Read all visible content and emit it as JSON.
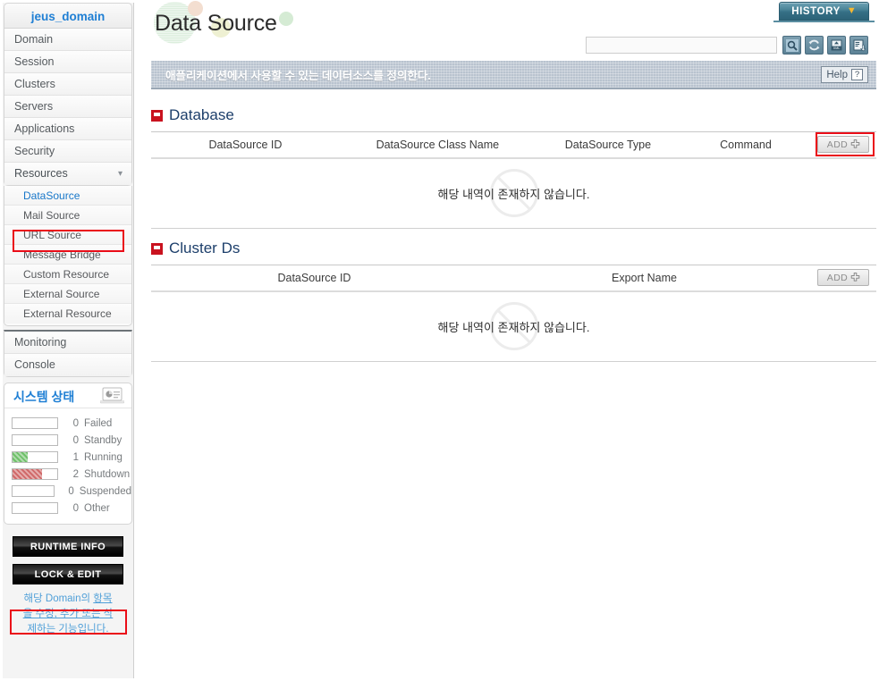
{
  "sidebar": {
    "domain_title": "jeus_domain",
    "nav_items": [
      {
        "label": "Domain"
      },
      {
        "label": "Session"
      },
      {
        "label": "Clusters"
      },
      {
        "label": "Servers"
      },
      {
        "label": "Applications"
      },
      {
        "label": "Security"
      }
    ],
    "resources": {
      "label": "Resources",
      "chevron": "chevron-down"
    },
    "sub_items": [
      {
        "label": "DataSource",
        "active": true
      },
      {
        "label": "Mail Source",
        "active": false
      },
      {
        "label": "URL Source",
        "active": false
      },
      {
        "label": "Message Bridge",
        "active": false
      },
      {
        "label": "Custom Resource",
        "active": false
      },
      {
        "label": "External Source",
        "active": false
      },
      {
        "label": "External Resource",
        "active": false
      }
    ],
    "nav_items2": [
      {
        "label": "Monitoring"
      },
      {
        "label": "Console"
      }
    ],
    "status": {
      "title": "시스템 상태",
      "rows": [
        {
          "count": "0",
          "label": "Failed",
          "fill_pct": 0,
          "color": "none"
        },
        {
          "count": "0",
          "label": "Standby",
          "fill_pct": 0,
          "color": "none"
        },
        {
          "count": "1",
          "label": "Running",
          "fill_pct": 33,
          "color": "green"
        },
        {
          "count": "2",
          "label": "Shutdown",
          "fill_pct": 66,
          "color": "red"
        },
        {
          "count": "0",
          "label": "Suspended",
          "fill_pct": 0,
          "color": "none"
        },
        {
          "count": "0",
          "label": "Other",
          "fill_pct": 0,
          "color": "none"
        }
      ]
    },
    "buttons": {
      "runtime_info": "RUNTIME INFO",
      "lock_and_edit": "LOCK & EDIT"
    },
    "lock_desc": {
      "part1": "해당 Domain의 ",
      "link1": "항목을 수정, 추가 또는 삭제",
      "part2": "하는 기능입니다."
    }
  },
  "header": {
    "page_title": "Data Source",
    "history_label": "HISTORY",
    "search_value": "",
    "search_placeholder": "",
    "tools": [
      {
        "name": "search-icon"
      },
      {
        "name": "refresh-icon"
      },
      {
        "name": "xml-export-icon"
      },
      {
        "name": "export-icon"
      }
    ],
    "description": "애플리케이션에서 사용할 수 있는 데이터소스를 정의한다.",
    "help_label": "Help",
    "help_mark": "?"
  },
  "sections": [
    {
      "title": "Database",
      "columns": [
        "DataSource ID",
        "DataSource Class Name",
        "DataSource Type",
        "Command"
      ],
      "add_label": "ADD",
      "empty_text": "해당 내역이 존재하지 않습니다.",
      "rows": []
    },
    {
      "title": "Cluster Ds",
      "columns": [
        "DataSource ID",
        "Export Name"
      ],
      "add_label": "ADD",
      "empty_text": "해당 내역이 존재하지 않습니다.",
      "rows": []
    }
  ],
  "colors": {
    "accent_blue": "#1f7fd4",
    "annotation_red": "#ea0d18",
    "section_red": "#c9121f",
    "history_teal": "#356f85",
    "running_green": "#6fc06a",
    "shutdown_red": "#d06a6a"
  }
}
